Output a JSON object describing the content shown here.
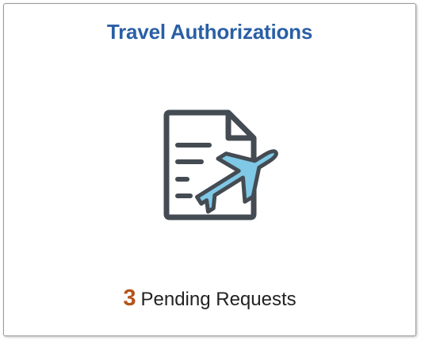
{
  "tile": {
    "title": "Travel Authorizations",
    "icon": "document-airplane-icon",
    "count": "3",
    "count_label": "Pending Requests"
  },
  "colors": {
    "title": "#2a5fa6",
    "count": "#b5531a",
    "icon_stroke": "#444b52",
    "plane_fill": "#7fc8e6"
  }
}
